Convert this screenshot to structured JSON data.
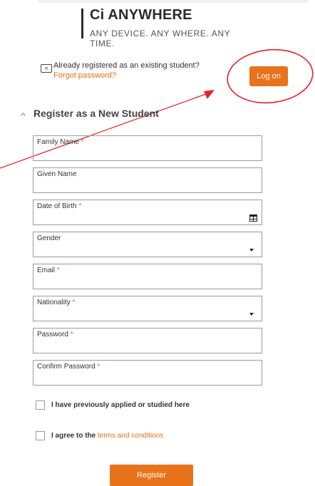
{
  "brand": {
    "title": "Ci ANYWHERE",
    "tagline": "ANY DEVICE. ANY WHERE. ANY TIME."
  },
  "existing": {
    "icon": "id-card-icon",
    "prompt": "Already registered as an existing student?",
    "forgot": "Forgot password?",
    "logon_label": "Log on"
  },
  "register_section": {
    "title": "Register as a New Student",
    "toggle_icon": "chevron-up-icon"
  },
  "fields": {
    "family_name": {
      "label": "Family Name",
      "required": "*",
      "value": ""
    },
    "given_name": {
      "label": "Given Name",
      "value": ""
    },
    "dob": {
      "label": "Date of Birth",
      "required": "*",
      "value": "",
      "icon": "calendar-icon"
    },
    "gender": {
      "label": "Gender",
      "value": "",
      "icon": "caret-down-icon"
    },
    "email": {
      "label": "Email",
      "required": "*",
      "value": ""
    },
    "nationality": {
      "label": "Nationality",
      "required": "*",
      "value": "",
      "icon": "caret-down-icon"
    },
    "password": {
      "label": "Password",
      "required": "*",
      "value": ""
    },
    "confirm_password": {
      "label": "Confirm Password",
      "required": "*",
      "value": ""
    }
  },
  "checkboxes": {
    "previously": {
      "label": "I have previously applied or studied here",
      "checked": false
    },
    "agree": {
      "label": "I agree to the ",
      "link": "terms and conditions",
      "checked": false
    }
  },
  "register_label": "Register",
  "annotation_color": "#e8202a",
  "accent_color": "#e8731a"
}
